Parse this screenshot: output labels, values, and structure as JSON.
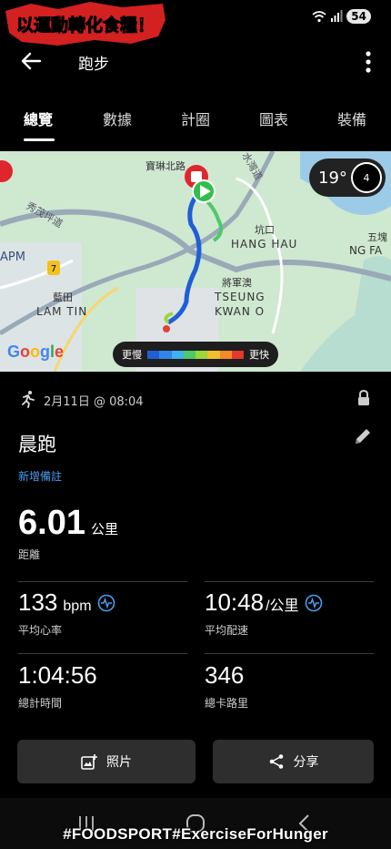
{
  "watermark": {
    "top_text": "以運動轉化食糧！",
    "bottom_text": "#FOODSPORT#ExerciseForHunger"
  },
  "status": {
    "battery": "54"
  },
  "appbar": {
    "title": "跑步"
  },
  "tabs": [
    {
      "label": "總覽",
      "active": true
    },
    {
      "label": "數據",
      "active": false
    },
    {
      "label": "計圈",
      "active": false
    },
    {
      "label": "圖表",
      "active": false
    },
    {
      "label": "裝備",
      "active": false
    }
  ],
  "map": {
    "weather_temp": "19°",
    "weather_badge": "4",
    "legend_slow": "更慢",
    "legend_fast": "更快",
    "legend_colors": [
      "#1f5fd6",
      "#2f86e8",
      "#3fb0f0",
      "#4fc86a",
      "#9bd63a",
      "#f0c030",
      "#f08a2a",
      "#e23a2a"
    ],
    "places": [
      "寶琳北路",
      "將軍澳",
      "TSEUNG",
      "KWAN O",
      "坑口",
      "HANG HAU",
      "藍田",
      "LAM TIN",
      "五塊",
      "NG FA",
      "秀茂坪道",
      "APM",
      "水灣道"
    ],
    "road_badges": [
      "7"
    ],
    "google": "Google"
  },
  "workout": {
    "datetime": "2月11日 @ 08:04",
    "title": "晨跑",
    "add_note": "新增備註",
    "distance": {
      "value": "6.01",
      "unit": "公里",
      "label": "距離"
    },
    "heart_rate": {
      "value": "133",
      "unit": "bpm",
      "label": "平均心率"
    },
    "pace": {
      "value": "10:48",
      "unit": "/公里",
      "label": "平均配速"
    },
    "duration": {
      "value": "1:04:56",
      "label": "總計時間"
    },
    "calories": {
      "value": "346",
      "label": "總卡路里"
    }
  },
  "actions": {
    "photos": "照片",
    "share": "分享"
  }
}
